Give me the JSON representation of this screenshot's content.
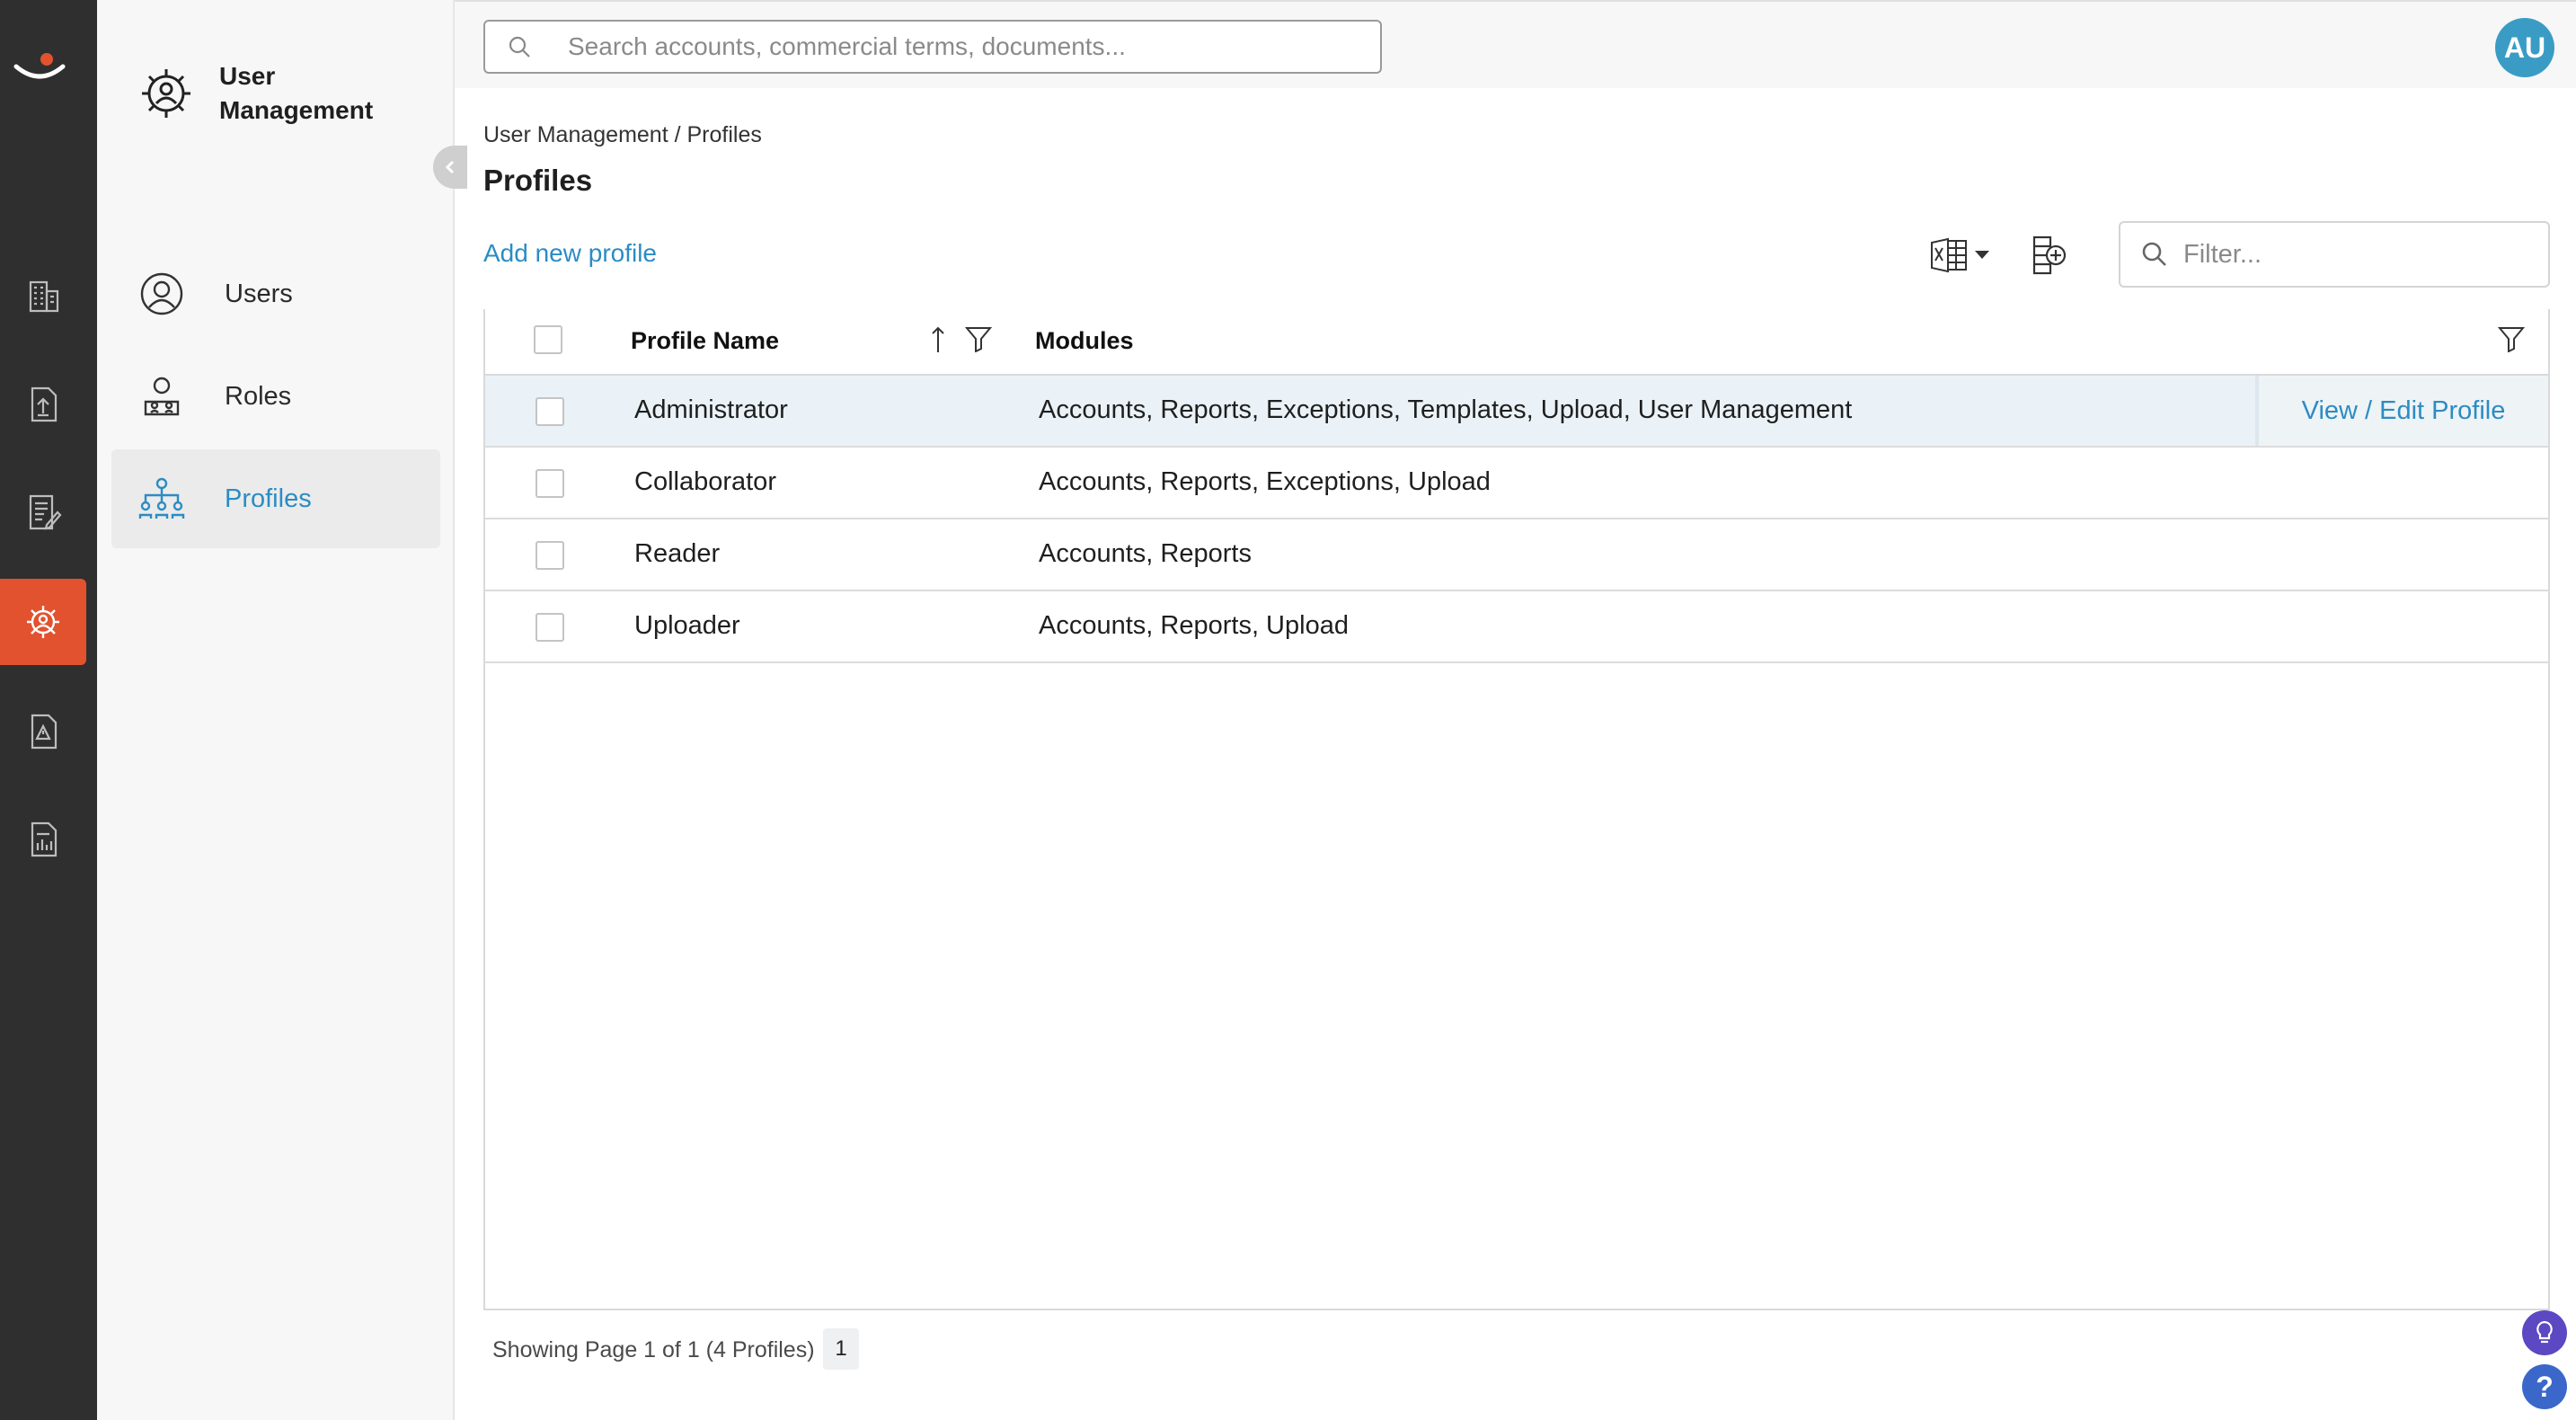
{
  "app": {
    "module_title": "User Management",
    "avatar_initials": "AU"
  },
  "rail": {
    "items": [
      {
        "icon": "building-icon"
      },
      {
        "icon": "upload-icon"
      },
      {
        "icon": "document-edit-icon"
      },
      {
        "icon": "settings-gear-icon",
        "active": true
      },
      {
        "icon": "exception-icon"
      },
      {
        "icon": "report-icon"
      }
    ]
  },
  "sidebar": {
    "items": [
      {
        "label": "Users",
        "icon": "user-circle-icon"
      },
      {
        "label": "Roles",
        "icon": "roles-icon"
      },
      {
        "label": "Profiles",
        "icon": "hierarchy-icon",
        "active": true
      }
    ]
  },
  "search": {
    "placeholder": "Search accounts, commercial terms, documents..."
  },
  "breadcrumb": "User Management / Profiles",
  "page_title": "Profiles",
  "toolbar": {
    "add_label": "Add new profile",
    "filter_placeholder": "Filter..."
  },
  "table": {
    "columns": [
      "Profile Name",
      "Modules"
    ],
    "rows": [
      {
        "name": "Administrator",
        "modules": "Accounts, Reports, Exceptions, Templates, Upload, User Management",
        "action": "View / Edit Profile"
      },
      {
        "name": "Collaborator",
        "modules": "Accounts, Reports, Exceptions, Upload"
      },
      {
        "name": "Reader",
        "modules": "Accounts, Reports"
      },
      {
        "name": "Uploader",
        "modules": "Accounts, Reports, Upload"
      }
    ]
  },
  "pager": {
    "summary": "Showing Page 1 of 1 (4 Profiles)",
    "current": "1"
  },
  "help": {
    "help_glyph": "?"
  },
  "colors": {
    "accent": "#2b8cc4",
    "active_rail": "#e2522f",
    "rail_bg": "#2f2f2f",
    "avatar_bg": "#3a9cc5"
  }
}
